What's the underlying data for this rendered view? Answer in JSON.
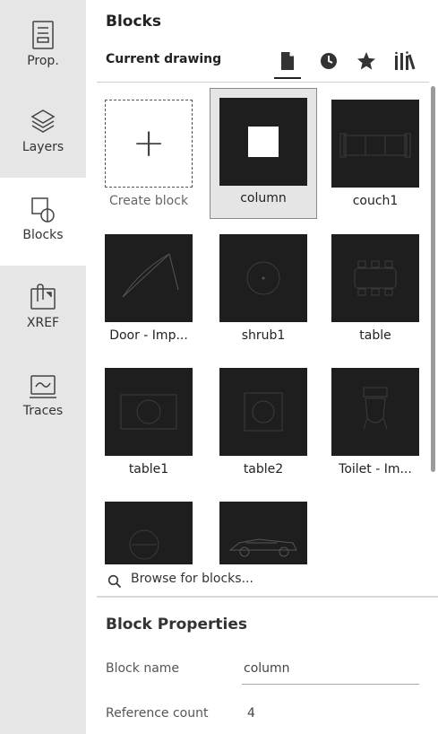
{
  "sidebar": {
    "items": [
      {
        "label": "Prop.",
        "icon": "properties-icon"
      },
      {
        "label": "Layers",
        "icon": "layers-icon"
      },
      {
        "label": "Blocks",
        "icon": "blocks-icon",
        "active": true
      },
      {
        "label": "XREF",
        "icon": "xref-icon"
      },
      {
        "label": "Traces",
        "icon": "traces-icon"
      }
    ]
  },
  "panel": {
    "title": "Blocks",
    "subtitle": "Current drawing",
    "tabs": [
      {
        "icon": "document-icon",
        "active": true
      },
      {
        "icon": "clock-icon"
      },
      {
        "icon": "star-icon"
      },
      {
        "icon": "library-icon"
      }
    ]
  },
  "blocks": {
    "create_label": "Create block",
    "items": [
      {
        "label": "column",
        "selected": true
      },
      {
        "label": "couch1"
      },
      {
        "label": "Door - Imp..."
      },
      {
        "label": "shrub1"
      },
      {
        "label": "table"
      },
      {
        "label": "table1"
      },
      {
        "label": "table2"
      },
      {
        "label": "Toilet - Im..."
      },
      {
        "label": ""
      },
      {
        "label": ""
      }
    ]
  },
  "browse": {
    "label": "Browse for blocks..."
  },
  "properties": {
    "title": "Block Properties",
    "name_label": "Block name",
    "name_value": "column",
    "count_label": "Reference count",
    "count_value": "4"
  },
  "colors": {
    "sidebar_bg": "#e6e6e6",
    "thumb_bg": "#1e1e1e",
    "selected_bg": "#e5e5e5"
  }
}
